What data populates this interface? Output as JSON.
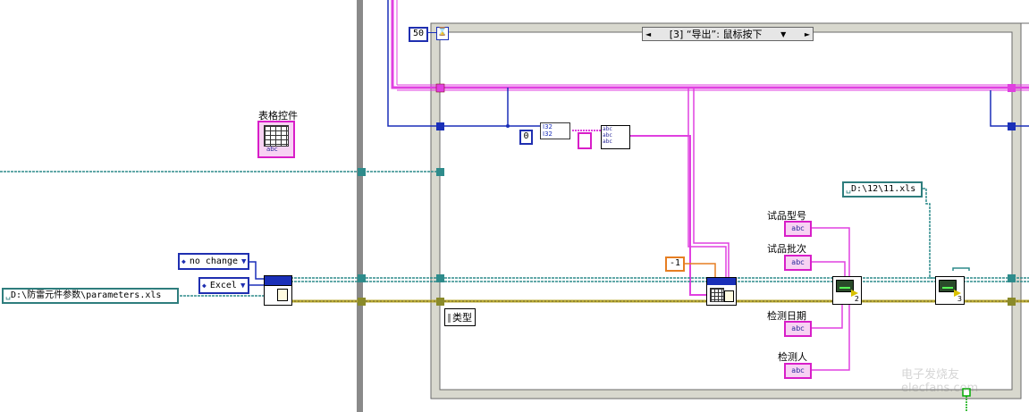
{
  "table_control": {
    "label": "表格控件",
    "terminal_text": "abc"
  },
  "loop": {
    "timeout_value": "50",
    "timeout_icon": "hourglass-icon"
  },
  "case_selector": {
    "prev": "◄",
    "value": "[3] “导出”: 鼠标按下",
    "dropdown": "▼",
    "next": "►"
  },
  "constants": {
    "path_in": "D:\\防雷元件参数\\parameters.xls",
    "no_change": "no change",
    "excel": "Excel",
    "path_out": "D:\\12\\11.xls",
    "zero": "0",
    "minus_one": "-1",
    "type_label": "类型"
  },
  "string_controls": [
    {
      "label": "试品型号",
      "terminal_text": "abc"
    },
    {
      "label": "试品批次",
      "terminal_text": "abc"
    },
    {
      "label": "检测日期",
      "terminal_text": "abc"
    },
    {
      "label": "检测人",
      "terminal_text": "abc"
    }
  ],
  "subvi_numbers": {
    "mid": "2",
    "right": "3"
  },
  "watermark": "电子发烧友 elecfans.com",
  "colors": {
    "wire_cyan": "#2e8b8b",
    "wire_pink": "#e040e0",
    "wire_blue": "#1a2fb8",
    "wire_yellow": "#b8a830",
    "frame_gray": "#d2d2c8"
  }
}
